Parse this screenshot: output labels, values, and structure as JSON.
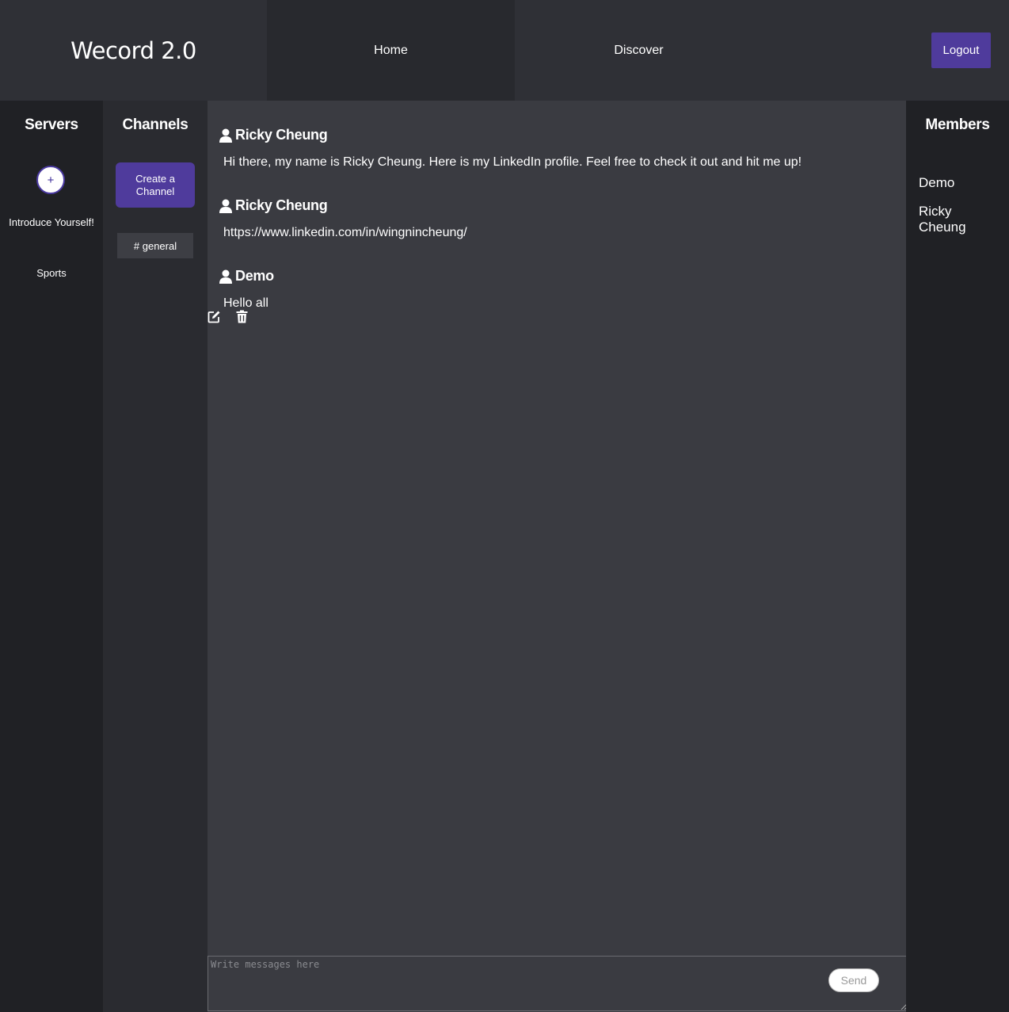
{
  "header": {
    "brand": "Wecord 2.0",
    "nav_home": "Home",
    "nav_discover": "Discover",
    "logout_label": "Logout"
  },
  "servers": {
    "title": "Servers",
    "add_label": "+",
    "items": [
      "Introduce Yourself!",
      "Sports"
    ]
  },
  "channels": {
    "title": "Channels",
    "create_label": "Create a Channel",
    "items": [
      "# general"
    ]
  },
  "messages": [
    {
      "user": "Ricky Cheung",
      "text": "Hi there, my name is Ricky Cheung. Here is my LinkedIn profile. Feel free to check it out and hit me up!"
    },
    {
      "user": "Ricky Cheung",
      "text": "https://www.linkedin.com/in/wingnincheung/"
    },
    {
      "user": "Demo",
      "text": "Hello all"
    }
  ],
  "message_actions": {
    "edit_icon": "edit-icon",
    "delete_icon": "trash-icon"
  },
  "composer": {
    "placeholder": "Write messages here",
    "send_label": "Send"
  },
  "members": {
    "title": "Members",
    "items": [
      "Demo",
      "Ricky Cheung"
    ]
  },
  "colors": {
    "accent": "#4f3b9c",
    "background": "#202125",
    "header": "#2f3036",
    "chat": "#3a3b41"
  }
}
